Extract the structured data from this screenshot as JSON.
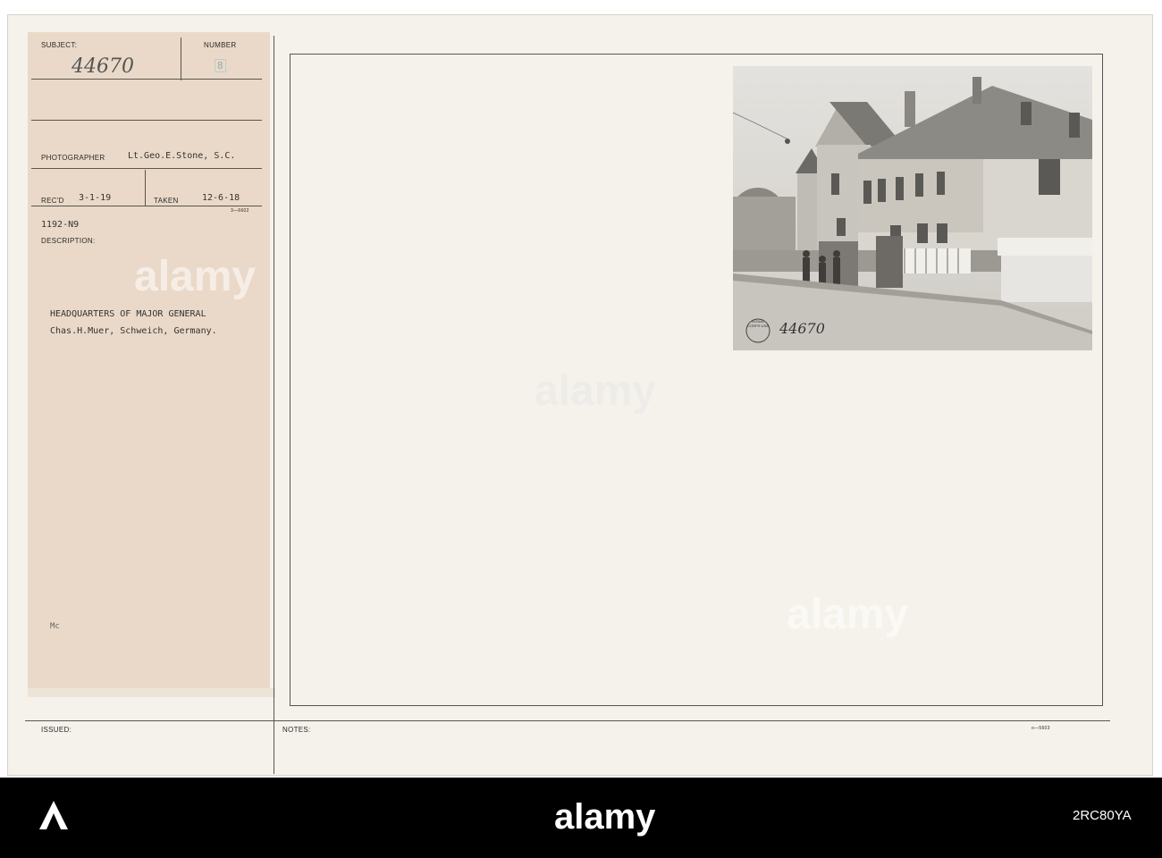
{
  "slip": {
    "subject_label": "SUBJECT:",
    "subject_value": "44670",
    "number_label": "NUMBER",
    "number_value": "8",
    "photographer_label": "PHOTOGRAPHER",
    "photographer_value": "Lt.Geo.E.Stone, S.C.",
    "recd_label": "REC'D",
    "recd_value": "3-1-19",
    "taken_label": "TAKEN",
    "taken_value": "12-6-18",
    "form_code": "3—6602",
    "file_code": "1192-N9",
    "description_label": "DESCRIPTION:",
    "description_line1": "HEADQUARTERS OF MAJOR GENERAL",
    "description_line2": "Chas.H.Muer, Schweich, Germany.",
    "initials": "Mc",
    "issued_label": "ISSUED:"
  },
  "notes_label": "NOTES:",
  "card_code": "o—5603",
  "photo": {
    "stamp_text": "SIGNAL CORPS USA",
    "stamp_number": "44670"
  },
  "watermark": "alamy",
  "footer": {
    "logo": "alamy",
    "image_id": "2RC80YA"
  },
  "colors": {
    "paper": "#f5f2ec",
    "slip": "#ead9c8",
    "footer": "#000000"
  }
}
